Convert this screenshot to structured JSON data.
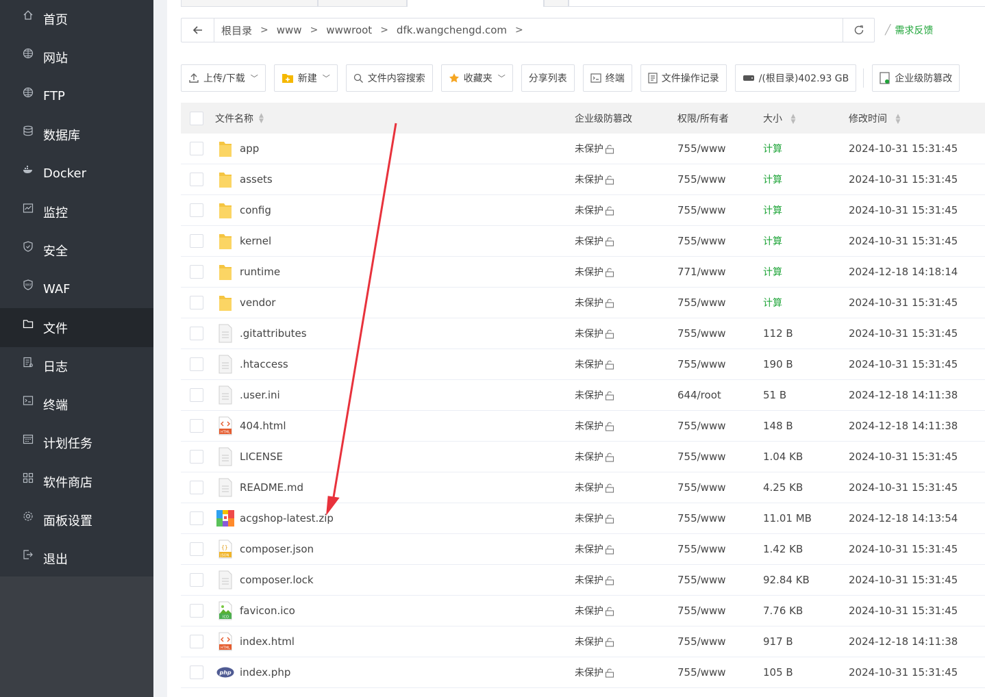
{
  "sidebar": {
    "items": [
      {
        "label": "首页",
        "icon": "home-icon"
      },
      {
        "label": "网站",
        "icon": "globe-icon"
      },
      {
        "label": "FTP",
        "icon": "globe-icon"
      },
      {
        "label": "数据库",
        "icon": "database-icon"
      },
      {
        "label": "Docker",
        "icon": "docker-icon"
      },
      {
        "label": "监控",
        "icon": "monitor-icon"
      },
      {
        "label": "安全",
        "icon": "shield-icon"
      },
      {
        "label": "WAF",
        "icon": "waf-shield-icon"
      },
      {
        "label": "文件",
        "icon": "folder-icon",
        "active": true
      },
      {
        "label": "日志",
        "icon": "log-icon"
      },
      {
        "label": "终端",
        "icon": "terminal-icon"
      },
      {
        "label": "计划任务",
        "icon": "calendar-icon"
      },
      {
        "label": "软件商店",
        "icon": "apps-icon"
      },
      {
        "label": "面板设置",
        "icon": "gear-icon"
      },
      {
        "label": "退出",
        "icon": "logout-icon"
      }
    ]
  },
  "breadcrumb": {
    "items": [
      "根目录",
      "www",
      "wwwroot",
      "dfk.wangchengd.com"
    ]
  },
  "feedback_label": "需求反馈",
  "toolbar": {
    "upload": "上传/下载",
    "new": "新建",
    "search": "文件内容搜索",
    "favorites": "收藏夹",
    "share": "分享列表",
    "terminal": "终端",
    "oplog": "文件操作记录",
    "disk": "/(根目录)402.93 GB",
    "tamper": "企业级防篡改"
  },
  "table": {
    "headers": {
      "name": "文件名称",
      "protect": "企业级防篡改",
      "perm": "权限/所有者",
      "size": "大小",
      "mtime": "修改时间"
    },
    "rows": [
      {
        "name": "app",
        "type": "folder",
        "protect": "未保护",
        "perm": "755/www",
        "size": "计算",
        "mtime": "2024-10-31 15:31:45"
      },
      {
        "name": "assets",
        "type": "folder",
        "protect": "未保护",
        "perm": "755/www",
        "size": "计算",
        "mtime": "2024-10-31 15:31:45"
      },
      {
        "name": "config",
        "type": "folder",
        "protect": "未保护",
        "perm": "755/www",
        "size": "计算",
        "mtime": "2024-10-31 15:31:45"
      },
      {
        "name": "kernel",
        "type": "folder",
        "protect": "未保护",
        "perm": "755/www",
        "size": "计算",
        "mtime": "2024-10-31 15:31:45"
      },
      {
        "name": "runtime",
        "type": "folder",
        "protect": "未保护",
        "perm": "771/www",
        "size": "计算",
        "mtime": "2024-12-18 14:18:14"
      },
      {
        "name": "vendor",
        "type": "folder",
        "protect": "未保护",
        "perm": "755/www",
        "size": "计算",
        "mtime": "2024-10-31 15:31:45"
      },
      {
        "name": ".gitattributes",
        "type": "file",
        "protect": "未保护",
        "perm": "755/www",
        "size": "112 B",
        "mtime": "2024-10-31 15:31:45"
      },
      {
        "name": ".htaccess",
        "type": "file",
        "protect": "未保护",
        "perm": "755/www",
        "size": "190 B",
        "mtime": "2024-10-31 15:31:45"
      },
      {
        "name": ".user.ini",
        "type": "file",
        "protect": "未保护",
        "perm": "644/root",
        "size": "51 B",
        "mtime": "2024-12-18 14:11:38"
      },
      {
        "name": "404.html",
        "type": "html",
        "protect": "未保护",
        "perm": "755/www",
        "size": "148 B",
        "mtime": "2024-12-18 14:11:38"
      },
      {
        "name": "LICENSE",
        "type": "file",
        "protect": "未保护",
        "perm": "755/www",
        "size": "1.04 KB",
        "mtime": "2024-10-31 15:31:45"
      },
      {
        "name": "README.md",
        "type": "file",
        "protect": "未保护",
        "perm": "755/www",
        "size": "4.25 KB",
        "mtime": "2024-10-31 15:31:45"
      },
      {
        "name": "acgshop-latest.zip",
        "type": "zip",
        "protect": "未保护",
        "perm": "755/www",
        "size": "11.01 MB",
        "mtime": "2024-12-18 14:13:54"
      },
      {
        "name": "composer.json",
        "type": "json",
        "protect": "未保护",
        "perm": "755/www",
        "size": "1.42 KB",
        "mtime": "2024-10-31 15:31:45"
      },
      {
        "name": "composer.lock",
        "type": "file",
        "protect": "未保护",
        "perm": "755/www",
        "size": "92.84 KB",
        "mtime": "2024-10-31 15:31:45"
      },
      {
        "name": "favicon.ico",
        "type": "ico",
        "protect": "未保护",
        "perm": "755/www",
        "size": "7.76 KB",
        "mtime": "2024-10-31 15:31:45"
      },
      {
        "name": "index.html",
        "type": "html",
        "protect": "未保护",
        "perm": "755/www",
        "size": "917 B",
        "mtime": "2024-12-18 14:11:38"
      },
      {
        "name": "index.php",
        "type": "php",
        "protect": "未保护",
        "perm": "755/www",
        "size": "105 B",
        "mtime": "2024-10-31 15:31:45"
      }
    ]
  },
  "colors": {
    "accent": "#20a53a",
    "sidebar_bg": "#2f343b",
    "sidebar_active": "#23272c",
    "annotation_arrow": "#e8323c"
  }
}
